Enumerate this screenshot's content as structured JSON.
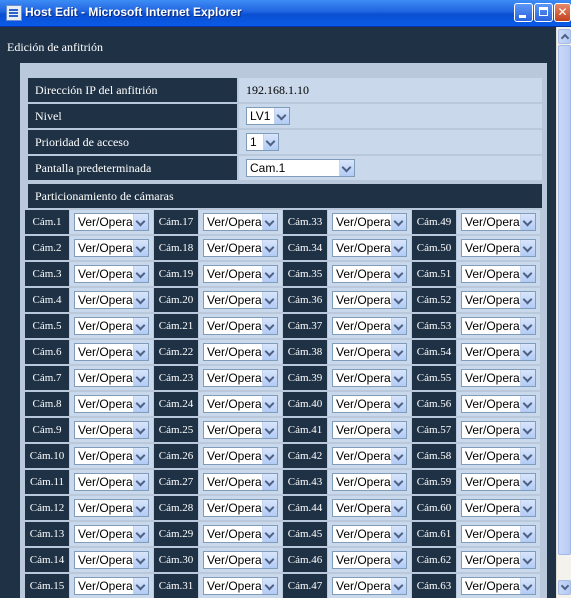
{
  "window": {
    "title": "Host Edit - Microsoft Internet Explorer"
  },
  "page": {
    "heading": "Edición de anfitrión"
  },
  "form": {
    "ip_label": "Dirección IP del anfitrión",
    "ip_value": "192.168.1.10",
    "level_label": "Nivel",
    "level_value": "LV1",
    "priority_label": "Prioridad de acceso",
    "priority_value": "1",
    "default_screen_label": "Pantalla predeterminada",
    "default_screen_value": "Cam.1"
  },
  "cameras": {
    "section_label": "Particionamiento de cámaras",
    "columns": [
      [
        {
          "label": "Cám.1",
          "value": "Ver/Operar"
        },
        {
          "label": "Cám.2",
          "value": "Ver/Operar"
        },
        {
          "label": "Cám.3",
          "value": "Ver/Operar"
        },
        {
          "label": "Cám.4",
          "value": "Ver/Operar"
        },
        {
          "label": "Cám.5",
          "value": "Ver/Operar"
        },
        {
          "label": "Cám.6",
          "value": "Ver/Operar"
        },
        {
          "label": "Cám.7",
          "value": "Ver/Operar"
        },
        {
          "label": "Cám.8",
          "value": "Ver/Operar"
        },
        {
          "label": "Cám.9",
          "value": "Ver/Operar"
        },
        {
          "label": "Cám.10",
          "value": "Ver/Operar"
        },
        {
          "label": "Cám.11",
          "value": "Ver/Operar"
        },
        {
          "label": "Cám.12",
          "value": "Ver/Operar"
        },
        {
          "label": "Cám.13",
          "value": "Ver/Operar"
        },
        {
          "label": "Cám.14",
          "value": "Ver/Operar"
        },
        {
          "label": "Cám.15",
          "value": "Ver/Operar"
        }
      ],
      [
        {
          "label": "Cám.17",
          "value": "Ver/Operar"
        },
        {
          "label": "Cám.18",
          "value": "Ver/Operar"
        },
        {
          "label": "Cám.19",
          "value": "Ver/Operar"
        },
        {
          "label": "Cám.20",
          "value": "Ver/Operar"
        },
        {
          "label": "Cám.21",
          "value": "Ver/Operar"
        },
        {
          "label": "Cám.22",
          "value": "Ver/Operar"
        },
        {
          "label": "Cám.23",
          "value": "Ver/Operar"
        },
        {
          "label": "Cám.24",
          "value": "Ver/Operar"
        },
        {
          "label": "Cám.25",
          "value": "Ver/Operar"
        },
        {
          "label": "Cám.26",
          "value": "Ver/Operar"
        },
        {
          "label": "Cám.27",
          "value": "Ver/Operar"
        },
        {
          "label": "Cám.28",
          "value": "Ver/Operar"
        },
        {
          "label": "Cám.29",
          "value": "Ver/Operar"
        },
        {
          "label": "Cám.30",
          "value": "Ver/Operar"
        },
        {
          "label": "Cám.31",
          "value": "Ver/Operar"
        }
      ],
      [
        {
          "label": "Cám.33",
          "value": "Ver/Operar"
        },
        {
          "label": "Cám.34",
          "value": "Ver/Operar"
        },
        {
          "label": "Cám.35",
          "value": "Ver/Operar"
        },
        {
          "label": "Cám.36",
          "value": "Ver/Operar"
        },
        {
          "label": "Cám.37",
          "value": "Ver/Operar"
        },
        {
          "label": "Cám.38",
          "value": "Ver/Operar"
        },
        {
          "label": "Cám.39",
          "value": "Ver/Operar"
        },
        {
          "label": "Cám.40",
          "value": "Ver/Operar"
        },
        {
          "label": "Cám.41",
          "value": "Ver/Operar"
        },
        {
          "label": "Cám.42",
          "value": "Ver/Operar"
        },
        {
          "label": "Cám.43",
          "value": "Ver/Operar"
        },
        {
          "label": "Cám.44",
          "value": "Ver/Operar"
        },
        {
          "label": "Cám.45",
          "value": "Ver/Operar"
        },
        {
          "label": "Cám.46",
          "value": "Ver/Operar"
        },
        {
          "label": "Cám.47",
          "value": "Ver/Operar"
        }
      ],
      [
        {
          "label": "Cám.49",
          "value": "Ver/Operar"
        },
        {
          "label": "Cám.50",
          "value": "Ver/Operar"
        },
        {
          "label": "Cám.51",
          "value": "Ver/Operar"
        },
        {
          "label": "Cám.52",
          "value": "Ver/Operar"
        },
        {
          "label": "Cám.53",
          "value": "Ver/Operar"
        },
        {
          "label": "Cám.54",
          "value": "Ver/Operar"
        },
        {
          "label": "Cám.55",
          "value": "Ver/Operar"
        },
        {
          "label": "Cám.56",
          "value": "Ver/Operar"
        },
        {
          "label": "Cám.57",
          "value": "Ver/Operar"
        },
        {
          "label": "Cám.58",
          "value": "Ver/Operar"
        },
        {
          "label": "Cám.59",
          "value": "Ver/Operar"
        },
        {
          "label": "Cám.60",
          "value": "Ver/Operar"
        },
        {
          "label": "Cám.61",
          "value": "Ver/Operar"
        },
        {
          "label": "Cám.62",
          "value": "Ver/Operar"
        },
        {
          "label": "Cám.63",
          "value": "Ver/Operar"
        }
      ]
    ]
  },
  "colors": {
    "page_background": "#1f3245",
    "label_cell": "#1f3245",
    "value_cell": "#c9d8ea",
    "title_bar": "#0a4fd2"
  },
  "icons": [
    "ie-window-icon",
    "minimize-icon",
    "maximize-icon",
    "close-icon",
    "chevron-down-icon",
    "scroll-up-icon",
    "scroll-down-icon"
  ]
}
